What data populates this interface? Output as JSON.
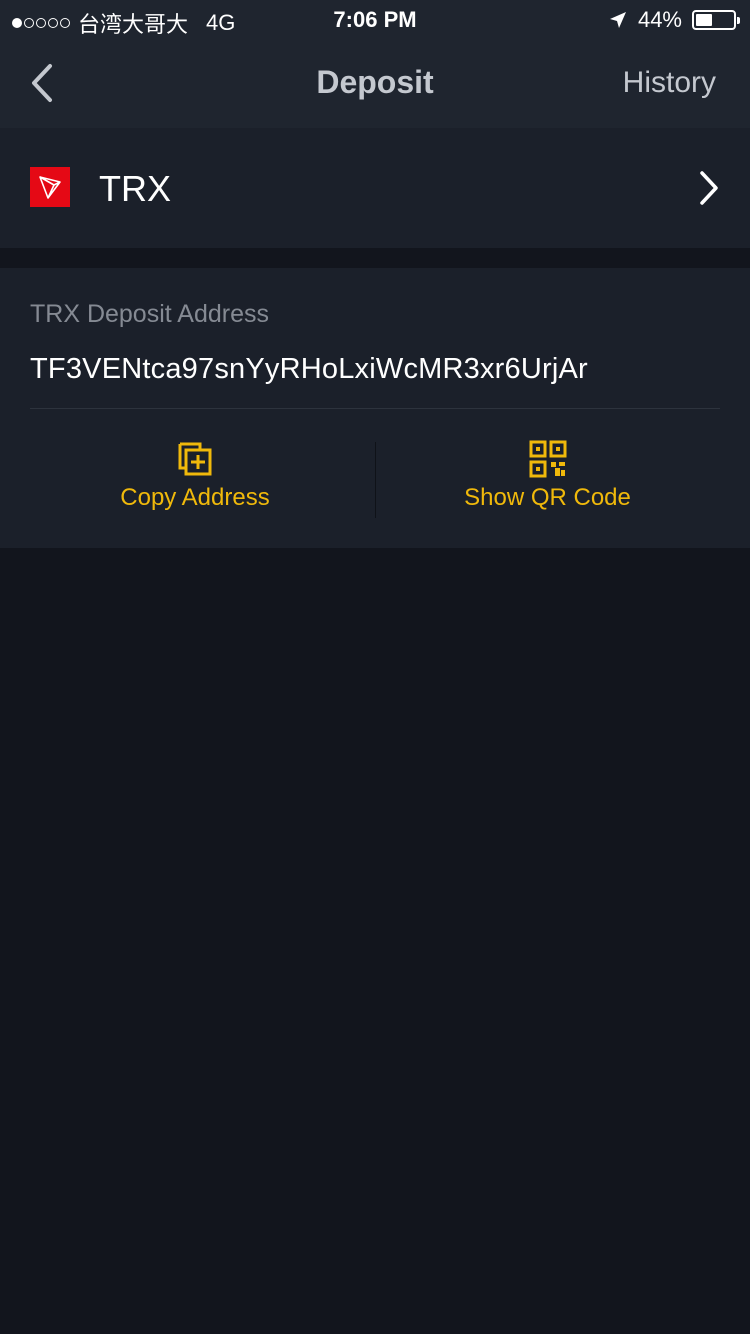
{
  "status_bar": {
    "carrier": "台湾大哥大",
    "network": "4G",
    "time": "7:06 PM",
    "battery": "44%",
    "battery_level": 0.44,
    "signal_bars_filled": 1,
    "signal_bars_total": 5
  },
  "nav": {
    "title": "Deposit",
    "history_label": "History"
  },
  "coin": {
    "symbol": "TRX",
    "icon": "tron-logo-icon",
    "brand_color": "#e50915"
  },
  "deposit": {
    "address_label": "TRX Deposit Address",
    "address": "TF3VENtca97snYyRHoLxiWcMR3xr6UrjAr"
  },
  "actions": {
    "copy_label": "Copy Address",
    "copy_icon": "copy-plus-icon",
    "qr_label": "Show QR Code",
    "qr_icon": "qr-code-icon"
  },
  "colors": {
    "accent": "#f0b90b",
    "background": "#12151d",
    "card": "#1b202a",
    "header": "#1f252f"
  }
}
